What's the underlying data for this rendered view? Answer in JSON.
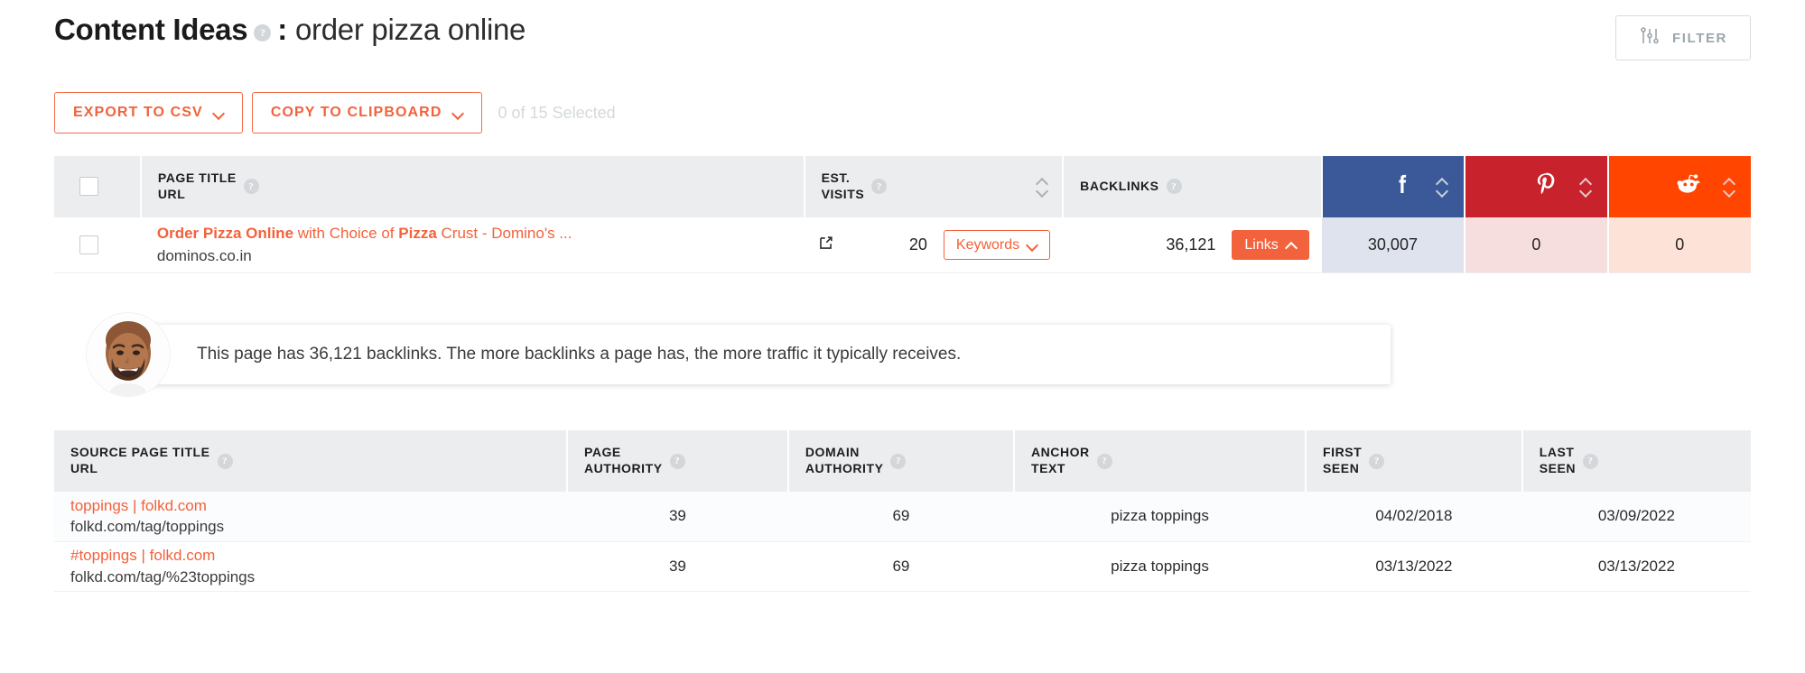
{
  "header": {
    "title": "Content Ideas",
    "separator": ":",
    "query": "order pizza online",
    "help_icon": "?",
    "filter_label": "FILTER",
    "filter_icon": "sliders-icon"
  },
  "toolbar": {
    "export_label": "EXPORT TO CSV",
    "copy_label": "COPY TO CLIPBOARD",
    "selected_text": "0 of 15 Selected",
    "chevron_icon": "chevron-down-icon"
  },
  "results_table": {
    "columns": {
      "page_title": "PAGE TITLE\nURL",
      "est_visits": "EST.\nVISITS",
      "backlinks": "BACKLINKS",
      "facebook": "facebook-icon",
      "pinterest": "pinterest-icon",
      "reddit": "reddit-icon"
    },
    "social_glyphs": {
      "facebook": "f",
      "pinterest": "P",
      "reddit": "●"
    },
    "rows": [
      {
        "title_parts": [
          {
            "text": "Order Pizza Online",
            "bold": true
          },
          {
            "text": " with Choice of ",
            "bold": false
          },
          {
            "text": "Pizza",
            "bold": true
          },
          {
            "text": " Crust - Domino's ...",
            "bold": false
          }
        ],
        "title_plain": "Order Pizza Online with Choice of Pizza Crust - Domino's ...",
        "url": "dominos.co.in",
        "external_icon": "external-link-icon",
        "est_visits": "20",
        "keywords_label": "Keywords",
        "backlinks": "36,121",
        "links_label": "Links",
        "facebook": "30,007",
        "pinterest": "0",
        "reddit": "0"
      }
    ]
  },
  "tip": {
    "avatar": "avatar-neil-patel",
    "text": "This page has 36,121 backlinks. The more backlinks a page has, the more traffic it typically receives."
  },
  "backlinks_table": {
    "columns": {
      "source": "SOURCE PAGE TITLE\nURL",
      "page_authority": "PAGE\nAUTHORITY",
      "domain_authority": "DOMAIN\nAUTHORITY",
      "anchor_text": "ANCHOR\nTEXT",
      "first_seen": "FIRST\nSEEN",
      "last_seen": "LAST\nSEEN"
    },
    "rows": [
      {
        "title": "toppings | folkd.com",
        "url": "folkd.com/tag/toppings",
        "page_authority": "39",
        "domain_authority": "69",
        "anchor_text": "pizza toppings",
        "first_seen": "04/02/2018",
        "last_seen": "03/09/2022"
      },
      {
        "title": "#toppings | folkd.com",
        "url": "folkd.com/tag/%23toppings",
        "page_authority": "39",
        "domain_authority": "69",
        "anchor_text": "pizza toppings",
        "first_seen": "03/13/2022",
        "last_seen": "03/13/2022"
      }
    ]
  },
  "colors": {
    "accent": "#f2623c",
    "facebook": "#3b5998",
    "pinterest": "#c8232c",
    "reddit": "#ff4500",
    "header_bg": "#ebedef"
  }
}
